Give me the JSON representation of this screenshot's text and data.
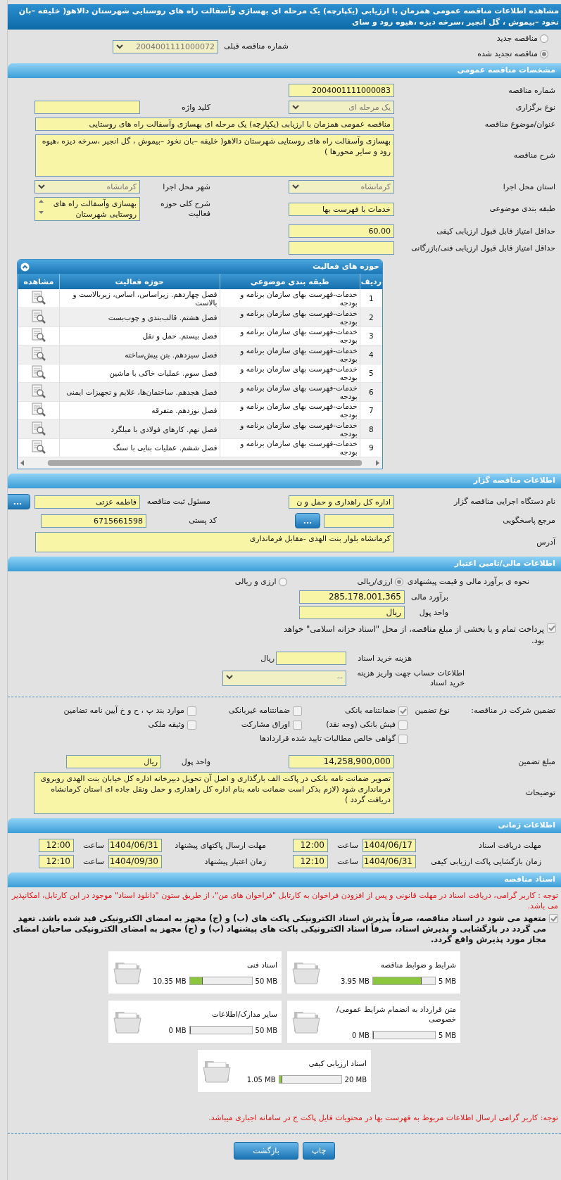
{
  "title": "مشاهده اطلاعات مناقصه عمومی همزمان با ارزیابی (یکپارچه) یک مرحله ای بهسازی وآسفالت راه های روستایی شهرستان دالاهو( خلیفه –بان نخود –بیموش ، گل انجیر ،سرخه دیزه ،هیوه رود و سای",
  "tender_mode": [
    {
      "label": "مناقصه جدید",
      "selected": false
    },
    {
      "label": "مناقصه تجدید شده",
      "selected": true
    }
  ],
  "previous_tender": {
    "label": "شماره مناقصه قبلی",
    "value": "2004001111000072",
    "disabled": true
  },
  "general": {
    "header": "مشخصات مناقصه عمومی",
    "rows": [
      {
        "cells": [
          {
            "label": "شماره مناقصه",
            "kind": "input",
            "value": "2004001111000083"
          }
        ]
      },
      {
        "cells": [
          {
            "label": "نوع برگزاری",
            "kind": "select",
            "value": "یک مرحله ای",
            "disabled": true
          },
          {
            "label": "کلید واژه",
            "kind": "input"
          }
        ]
      },
      {
        "wide": true,
        "cells": [
          {
            "label": "عنوان/موضوع مناقصه",
            "kind": "input",
            "value": "مناقصه عمومی همزمان با ارزیابی (یکپارچه) یک مرحله ای بهسازی وآسفالت راه های روستایی"
          }
        ]
      },
      {
        "wide": true,
        "cells": [
          {
            "label": "شرح مناقصه",
            "kind": "textarea",
            "value": "بهسازی وآسفالت راه های روستایی شهرستان دالاهو( خلیفه –بان نخود –بیموش ، گل انجیر ،سرخه دیزه ،هیوه رود و سایر محورها )"
          }
        ]
      },
      {
        "cells": [
          {
            "label": "استان محل اجرا",
            "kind": "select",
            "value": "کرمانشاه",
            "disabled": true
          },
          {
            "label": "شهر محل اجرا",
            "kind": "select",
            "value": "کرمانشاه",
            "disabled": true
          }
        ]
      },
      {
        "cells": [
          {
            "label": "طبقه بندی موضوعی",
            "kind": "input",
            "value": "خدمات با فهرست بها"
          },
          {
            "label": "شرح کلی حوزه فعالیت",
            "kind": "listbox",
            "value": "بهسازی وآسفالت راه های روستایی شهرستان"
          }
        ]
      },
      {
        "cells": [
          {
            "label": "حداقل امتیاز قابل قبول ارزیابی کیفی",
            "kind": "input",
            "value": "60.00"
          }
        ]
      },
      {
        "cells": [
          {
            "label": "حداقل امتیاز قابل قبول ارزیابی فنی/بازرگانی",
            "kind": "input"
          }
        ]
      }
    ]
  },
  "activities": {
    "title": "حوزه های فعالیت",
    "columns": [
      "ردیف",
      "طبقه بندی موضوعی",
      "حوزه فعالیت",
      "مشاهده"
    ],
    "rows": [
      {
        "index": "1",
        "category": "خدمات-فهرست بهای سازمان برنامه و بودجه",
        "activity": "فصل چهاردهم. زیراساس، اساس، زیربالاست  و بالاست"
      },
      {
        "index": "2",
        "category": "خدمات-فهرست بهای سازمان برنامه و بودجه",
        "activity": "فصل هشتم. قالب‌بندی و چوب‌بست"
      },
      {
        "index": "3",
        "category": "خدمات-فهرست بهای سازمان برنامه و بودجه",
        "activity": "فصل بیستم. حمل و نقل"
      },
      {
        "index": "4",
        "category": "خدمات-فهرست بهای سازمان برنامه و بودجه",
        "activity": "فصل سیزدهم. بتن پیش‌ساخته"
      },
      {
        "index": "5",
        "category": "خدمات-فهرست بهای سازمان برنامه و بودجه",
        "activity": "فصل سوم. عملیات خاکی با ماشین"
      },
      {
        "index": "6",
        "category": "خدمات-فهرست بهای سازمان برنامه و بودجه",
        "activity": "فصل هجدهم. ساختمان‌ها، علایم و تجهیزات ایمنی"
      },
      {
        "index": "7",
        "category": "خدمات-فهرست بهای سازمان برنامه و بودجه",
        "activity": "فصل نوزدهم. متفرقه"
      },
      {
        "index": "8",
        "category": "خدمات-فهرست بهای سازمان برنامه و بودجه",
        "activity": "فصل نهم. کارهای فولادی با میلگرد"
      },
      {
        "index": "9",
        "category": "خدمات-فهرست بهای سازمان برنامه و بودجه",
        "activity": "فصل ششم. عملیات بنایی با سنگ"
      }
    ]
  },
  "organizer": {
    "header": "اطلاعات مناقصه گزار",
    "rows": [
      {
        "cells": [
          {
            "label": "نام دستگاه اجرایی مناقصه گزار",
            "kind": "input",
            "value": "اداره کل راهداری و حمل و ن"
          },
          {
            "label": "مسئول ثبت مناقصه",
            "kind": "input",
            "value": "فاطمه  عزتی",
            "button": "..."
          }
        ]
      },
      {
        "cells": [
          {
            "label": "مرجع پاسخگویی",
            "kind": "input",
            "button": "..."
          },
          {
            "label": "کد پستی",
            "kind": "input",
            "value": "6715661598"
          }
        ]
      },
      {
        "wide": true,
        "cells": [
          {
            "label": "آدرس",
            "kind": "textarea",
            "value": "کرمانشاه بلوار بنت الهدی -مقابل فرمانداری"
          }
        ]
      }
    ]
  },
  "finance": {
    "header": "اطلاعات مالی/تامین اعتبار",
    "estimation_label": "نحوه ی برآورد مالی و قیمت پیشنهادی",
    "estimation_options": [
      {
        "label": "ارزی/ریالی",
        "selected": true
      },
      {
        "label": "ارزی و ریالی",
        "selected": false
      }
    ],
    "estimate": {
      "label": "برآورد مالی",
      "value": "285,178,001,365"
    },
    "currency": {
      "label": "واحد پول",
      "value": "ریال"
    },
    "treasury": {
      "label": "پرداخت تمام و یا بخشی از مبلغ مناقصه، از محل \"اسناد خزانه اسلامی\" خواهد بود.",
      "checked": true
    },
    "doc_fee": {
      "label": "هزینه خرید اسناد",
      "unit": "ریال"
    },
    "account": {
      "label": "اطلاعات حساب جهت واریز هزینه خرید اسناد",
      "value": "--"
    }
  },
  "guarantee": {
    "label": "تضمین شرکت در مناقصه:",
    "type_label": "نوع تضمین",
    "options": [
      {
        "label": "ضمانتنامه بانکی",
        "checked": true
      },
      {
        "label": "ضمانتنامه غیربانکی",
        "checked": false
      },
      {
        "label": "موارد بند پ ، ح و خ آیین نامه تضامین",
        "checked": false
      },
      {
        "label": "فیش بانکی (وجه نقد)",
        "checked": false
      },
      {
        "label": "اوراق مشارکت",
        "checked": false
      },
      {
        "label": "وثیقه ملکی",
        "checked": false
      },
      {
        "label": "گواهی خالص مطالبات تایید شده قراردادها",
        "checked": false
      }
    ],
    "amount": {
      "label": "مبلغ تضمین",
      "value": "14,258,900,000"
    },
    "currency": {
      "label": "واحد پول",
      "value": "ریال"
    },
    "notes": {
      "label": "توضیحات",
      "value": "تصویر ضمانت نامه بانکی در پاکت الف بارگذاری و اصل آن تحویل دبیرخانه اداره کل خیابان بنت الهدی روبروی فرمانداری شود  (لازم بذکر است ضمانت نامه بنام اداره کل راهداری و حمل ونقل جاده ای استان کرمانشاه دریافت گردد )"
    }
  },
  "timing": {
    "header": "اطلاعات زمانی",
    "rows": [
      [
        {
          "label": "مهلت دریافت اسناد",
          "date": "1404/06/17",
          "time_label": "ساعت",
          "time": "12:00"
        },
        {
          "label": "مهلت ارسال پاکتهای پیشنهاد",
          "date": "1404/06/31",
          "time_label": "ساعت",
          "time": "12:00"
        }
      ],
      [
        {
          "label": "زمان بازگشایی پاکت ارزیابی کیفی",
          "date": "1404/06/31",
          "time_label": "ساعت",
          "time": "12:10"
        },
        {
          "label": "زمان اعتبار پیشنهاد",
          "date": "1404/09/30",
          "time_label": "ساعت",
          "time": "12:10"
        }
      ]
    ]
  },
  "documents": {
    "header": "اسناد مناقصه",
    "notice": "توجه : کاربر گرامی، دریافت اسناد در مهلت قانونی و پس از افزودن فراخوان به کارتابل \"فراخوان های من\"، از طریق ستون \"دانلود اسناد\" موجود در این کارتابل، امکانپذیر می باشد.",
    "commitment": {
      "text": "متعهد می شود در اسناد مناقصه، صرفاً پذیرش اسناد الکترونیکی پاکت های (ب) و (ج) مجهز به امضای الکترونیکی قید شده باشد. تعهد می گردد در بازگشایی و پذیرش اسناد، صرفاً اسناد الکترونیکی پاکت های پیشنهاد (ب) و (ج) مجهز به امضای الکترونیکی صاحبان امضای مجاز مورد پذیرش واقع گردد.",
      "checked": true
    },
    "files": [
      {
        "name": "شرایط و ضوابط مناقصه",
        "limit": "5 MB",
        "used": "3.95 MB",
        "level": 0.79
      },
      {
        "name": "اسناد فنی",
        "limit": "50 MB",
        "used": "10.35 MB",
        "level": 0.207
      },
      {
        "name": "متن قرارداد به انضمام شرایط عمومی/خصوصی",
        "limit": "5 MB",
        "used": "0 MB",
        "level": 0
      },
      {
        "name": "سایر مدارک/اطلاعات",
        "limit": "50 MB",
        "used": "0 MB",
        "level": 0
      },
      {
        "name": "اسناد ارزیابی کیفی",
        "limit": "20 MB",
        "used": "1.05 MB",
        "level": 0.0525
      }
    ],
    "footer_notice": "توجه: کاربر گرامی ارسال اطلاعات مربوط به فهرست بها در محتویات فایل پاکت ج در سامانه اجباری میباشد."
  },
  "buttons": [
    "چاپ",
    "بازگشت"
  ]
}
